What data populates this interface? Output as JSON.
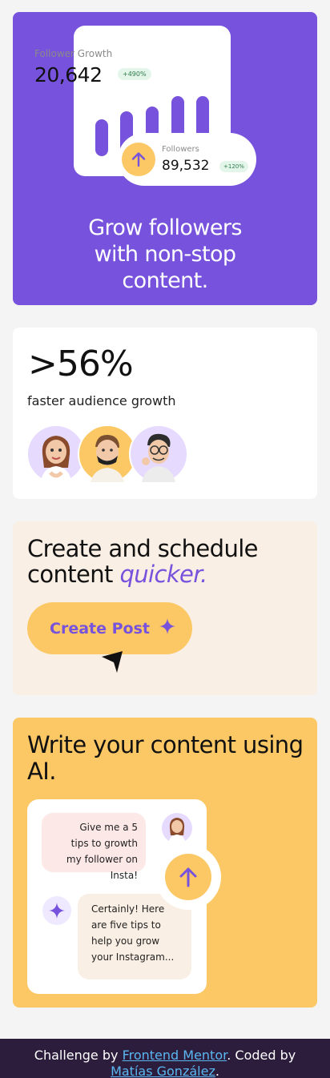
{
  "colors": {
    "purple": "#7752dc",
    "yellow": "#fcc865",
    "cream": "#faefe4",
    "footer_bg": "#2c1d3c",
    "link": "#5ab7f0"
  },
  "growth_card": {
    "title": "Follower Growth",
    "value": "20,642",
    "badge": "+490%",
    "followers_label": "Followers",
    "followers_value": "89,532",
    "followers_badge": "+120%",
    "heading": "Grow followers with non-stop content."
  },
  "stats_card": {
    "stat": ">56%",
    "subtitle": "faster audience growth",
    "avatars": [
      "avatar-woman",
      "avatar-man-mask",
      "avatar-man-glasses"
    ]
  },
  "schedule_card": {
    "heading_main": "Create and schedule content",
    "heading_accent": "quicker.",
    "button_label": "Create Post",
    "button_icon": "sparkle-icon",
    "cursor_icon": "cursor-arrow-icon"
  },
  "ai_card": {
    "heading": "Write your content using AI.",
    "user_message": "Give me a 5 tips to growth my follower on Insta!",
    "ai_message": "Certainly! Here are five tips to help you grow your Instagram...",
    "send_icon": "arrow-up-icon"
  },
  "footer": {
    "prefix": "Challenge by ",
    "link1": "Frontend Mentor",
    "middle": ". Coded by ",
    "link2": "Matías González",
    "suffix": "."
  }
}
